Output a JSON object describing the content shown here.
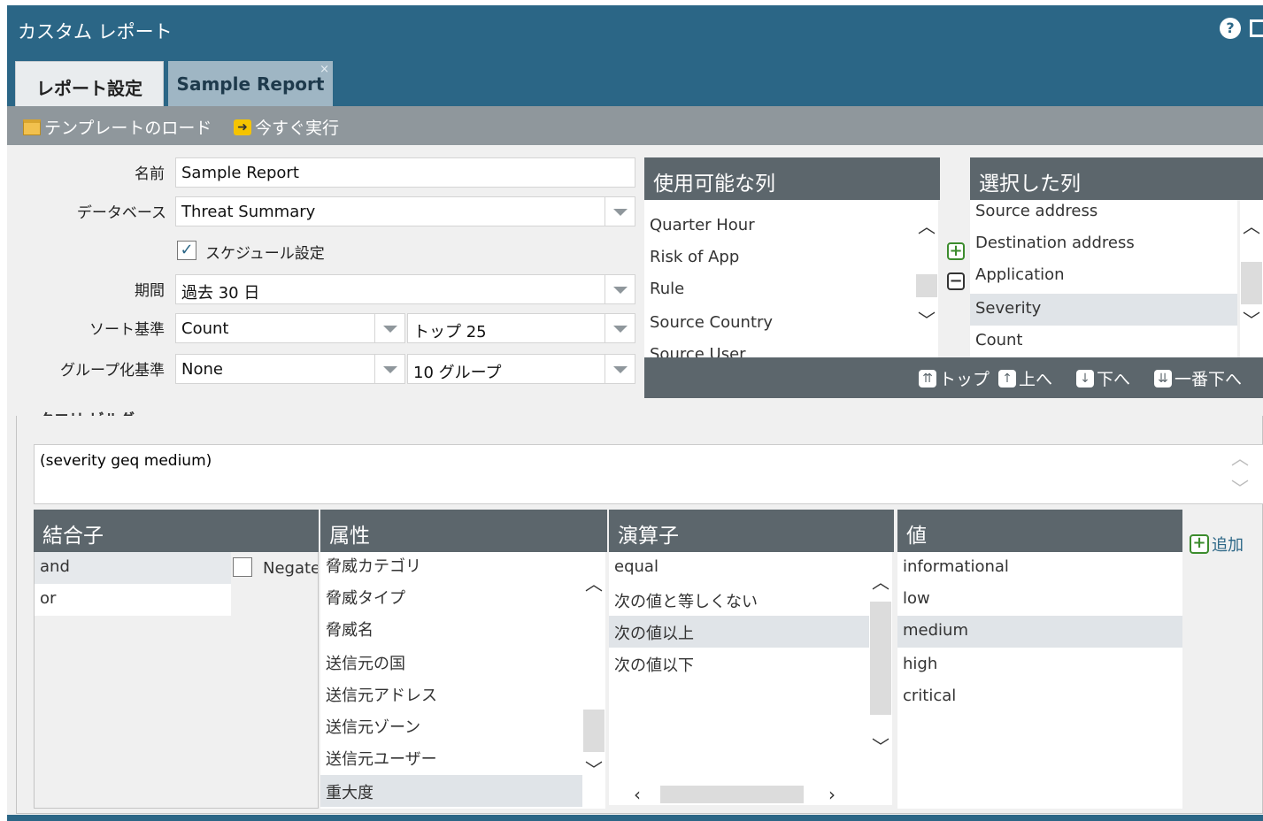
{
  "window": {
    "title": "カスタム レポート",
    "help_icon": "?"
  },
  "tabs": [
    {
      "label": "レポート設定",
      "active": true
    },
    {
      "label": "Sample Report",
      "active": false,
      "close": "×"
    }
  ],
  "toolbar": {
    "load_template": "テンプレートのロード",
    "run_now": "今すぐ実行"
  },
  "form": {
    "name_label": "名前",
    "name_value": "Sample Report",
    "database_label": "データベース",
    "database_value": "Threat Summary",
    "schedule_label": "スケジュール設定",
    "schedule_checked": true,
    "schedule_check": "✓",
    "period_label": "期間",
    "period_value": "過去 30 日",
    "sort_label": "ソート基準",
    "sort_value": "Count",
    "sort_top_value": "トップ 25",
    "group_label": "グループ化基準",
    "group_value": "None",
    "group_count_value": "10 グループ"
  },
  "available_columns": {
    "header": "使用可能な列",
    "items": [
      "Quarter Hour",
      "Risk of App",
      "Rule",
      "Source Country",
      "Source User"
    ]
  },
  "selected_columns": {
    "header": "選択した列",
    "items": [
      "Source address",
      "Destination address",
      "Application",
      "Severity",
      "Count"
    ],
    "selected": "Severity"
  },
  "column_actions": {
    "top": "トップ",
    "up": "上へ",
    "down": "下へ",
    "bottom": "一番下へ"
  },
  "query_builder": {
    "title": "クエリ ビルダー",
    "query": "(severity geq medium)",
    "connector": {
      "header": "結合子",
      "items": [
        "and",
        "or"
      ],
      "selected": "and",
      "negate_label": "Negate"
    },
    "attribute": {
      "header": "属性",
      "items": [
        "脅威カテゴリ",
        "脅威タイプ",
        "脅威名",
        "送信元の国",
        "送信元アドレス",
        "送信元ゾーン",
        "送信元ユーザー",
        "重大度"
      ],
      "selected": "重大度"
    },
    "operator": {
      "header": "演算子",
      "items": [
        "equal",
        "次の値と等しくない",
        "次の値以上",
        "次の値以下"
      ],
      "selected": "次の値以上"
    },
    "value": {
      "header": "値",
      "items": [
        "informational",
        "low",
        "medium",
        "high",
        "critical"
      ],
      "selected": "medium"
    },
    "add_label": "追加"
  },
  "colors": {
    "header_blue": "#2b6686",
    "list_header": "#5c666c",
    "toolbar": "#8f979c"
  }
}
